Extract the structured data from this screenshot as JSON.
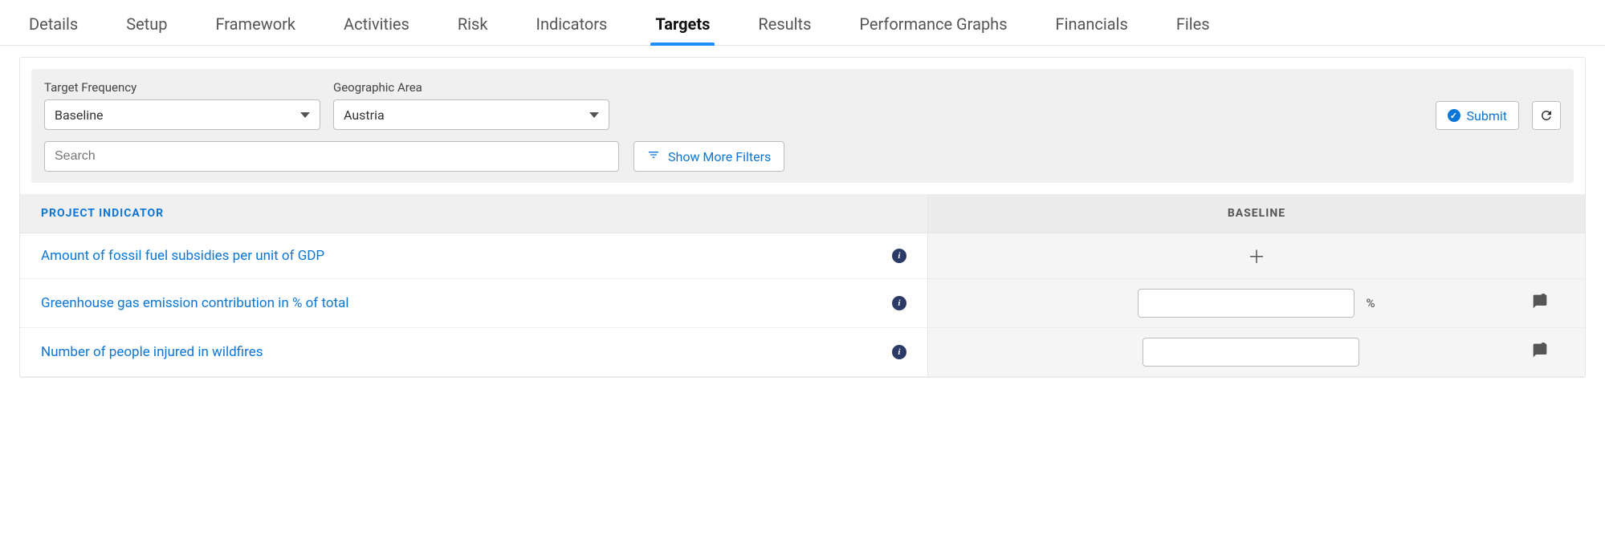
{
  "tabs": [
    {
      "label": "Details"
    },
    {
      "label": "Setup"
    },
    {
      "label": "Framework"
    },
    {
      "label": "Activities"
    },
    {
      "label": "Risk"
    },
    {
      "label": "Indicators"
    },
    {
      "label": "Targets",
      "selected": true
    },
    {
      "label": "Results"
    },
    {
      "label": "Performance Graphs"
    },
    {
      "label": "Financials"
    },
    {
      "label": "Files"
    }
  ],
  "filters": {
    "target_frequency": {
      "label": "Target Frequency",
      "value": "Baseline"
    },
    "geo_area": {
      "label": "Geographic Area",
      "value": "Austria"
    },
    "search_placeholder": "Search",
    "more_filters_label": "Show More Filters",
    "submit_label": "Submit"
  },
  "table": {
    "header_indicator": "PROJECT INDICATOR",
    "header_baseline": "BASELINE",
    "rows": [
      {
        "indicator": "Amount of fossil fuel subsidies per unit of GDP",
        "baseline_type": "add",
        "unit": ""
      },
      {
        "indicator": "Greenhouse gas emission contribution in % of total",
        "baseline_type": "input",
        "unit": "%"
      },
      {
        "indicator": "Number of people injured in wildfires",
        "baseline_type": "input",
        "unit": ""
      }
    ]
  }
}
